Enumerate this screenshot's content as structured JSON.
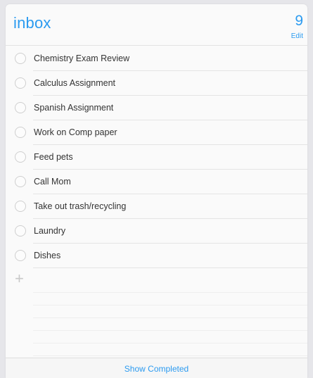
{
  "header": {
    "title": "inbox",
    "count": "9",
    "edit_label": "Edit"
  },
  "tasks": [
    {
      "label": "Chemistry Exam Review",
      "completed": false
    },
    {
      "label": "Calculus Assignment",
      "completed": false
    },
    {
      "label": "Spanish Assignment",
      "completed": false
    },
    {
      "label": "Work on Comp paper",
      "completed": false
    },
    {
      "label": "Feed pets",
      "completed": false
    },
    {
      "label": "Call Mom",
      "completed": false
    },
    {
      "label": "Take out trash/recycling",
      "completed": false
    },
    {
      "label": "Laundry",
      "completed": false
    },
    {
      "label": "Dishes",
      "completed": false
    }
  ],
  "add_icon": "plus-icon",
  "footer": {
    "show_completed_label": "Show Completed"
  },
  "colors": {
    "accent": "#2c9bf0",
    "text": "#333333",
    "circle_border": "#cfcfcf"
  }
}
